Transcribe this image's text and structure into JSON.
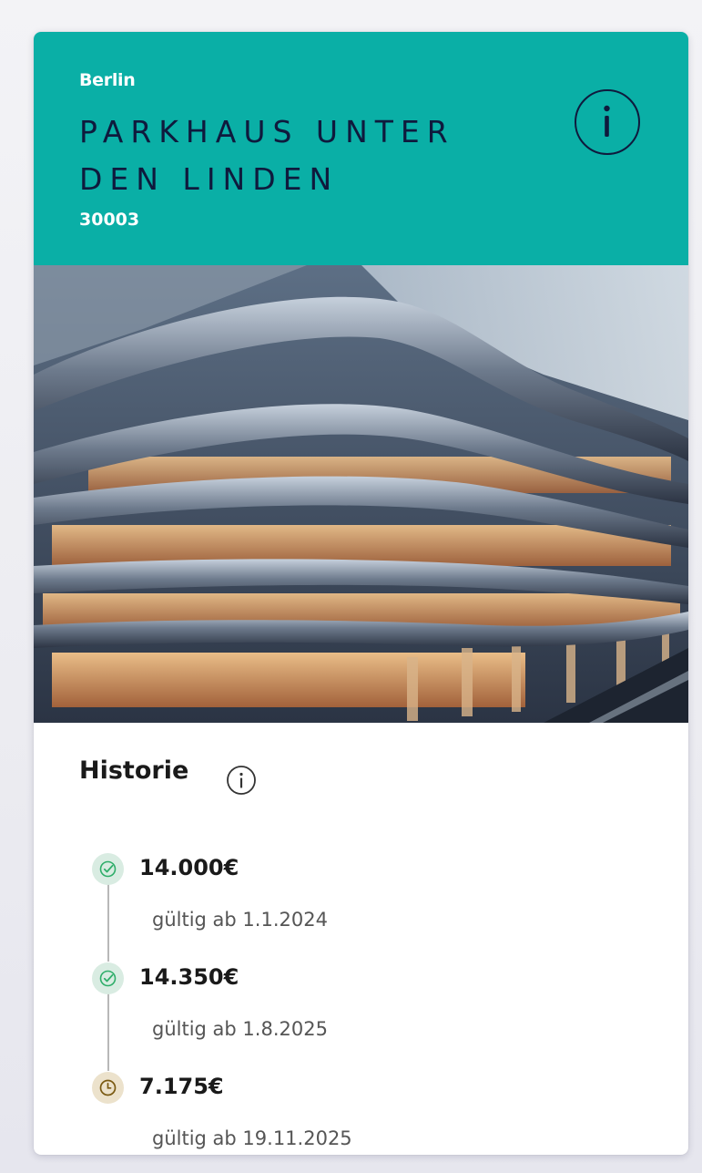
{
  "colors": {
    "header_bg": "#0aafa6",
    "title_text": "#0f1a3d",
    "valid_status": "#2fae6a",
    "pending_status": "#9a7a2a"
  },
  "parking": {
    "city": "Berlin",
    "name": "PARKHAUS UNTER DEN LINDEN",
    "code": "30003",
    "info_icon": "info-icon"
  },
  "image": {
    "subject": "parking-garage-building-photo"
  },
  "history": {
    "title": "Historie",
    "info_icon": "info-icon",
    "entries": [
      {
        "price": "14.000€",
        "valid": "gültig ab 1.1.2024",
        "status": "valid",
        "icon": "check-circle-icon"
      },
      {
        "price": "14.350€",
        "valid": "gültig ab 1.8.2025",
        "status": "valid",
        "icon": "check-circle-icon"
      },
      {
        "price": "7.175€",
        "valid": "gültig ab 19.11.2025",
        "status": "pending",
        "icon": "clock-icon"
      }
    ]
  }
}
